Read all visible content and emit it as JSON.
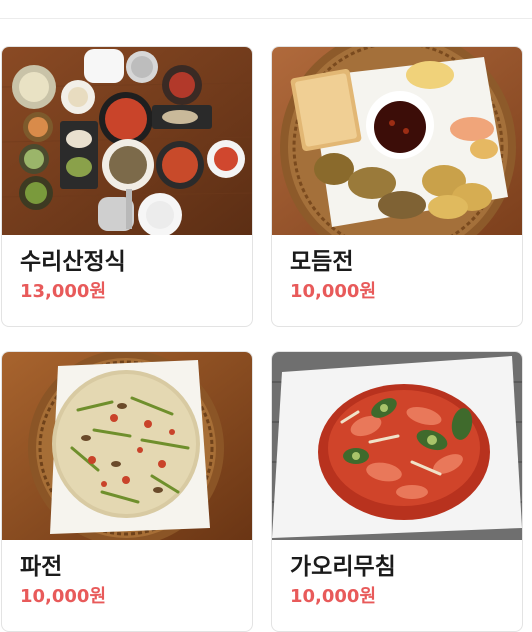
{
  "menu": {
    "items": [
      {
        "name": "수리산정식",
        "price": "13,000원",
        "image": "korean-set-meal-photo"
      },
      {
        "name": "모듬전",
        "price": "10,000원",
        "image": "assorted-pancakes-photo"
      },
      {
        "name": "파전",
        "price": "10,000원",
        "image": "green-onion-pancake-photo"
      },
      {
        "name": "가오리무침",
        "price": "10,000원",
        "image": "spicy-stingray-salad-photo"
      }
    ]
  },
  "colors": {
    "price": "#e85a5a",
    "name": "#1b1b1b",
    "border": "#e3e3e3"
  }
}
